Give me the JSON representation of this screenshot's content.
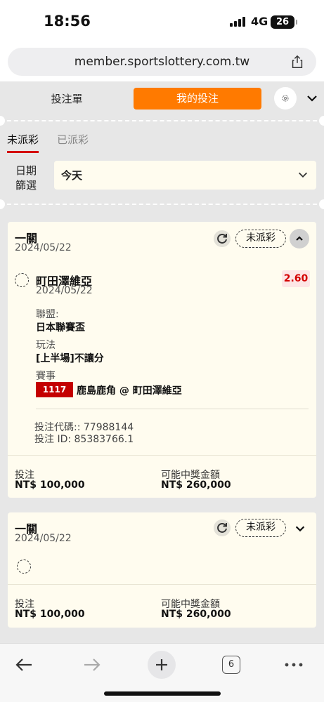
{
  "status_bar": {
    "time": "18:56",
    "network": "4G",
    "battery": "26"
  },
  "browser": {
    "url": "member.sportslottery.com.tw",
    "open_tabs": "6"
  },
  "nav": {
    "tab_bets": "投注單",
    "tab_my_bets": "我的投注",
    "accent_color": "#ff7a00"
  },
  "filters": {
    "tabs": [
      "未派彩",
      "已派彩"
    ],
    "active_tab": "未派彩",
    "date_label": "日期篩選",
    "date_label_line1": "日期",
    "date_label_line2": "篩選",
    "date_value": "今天"
  },
  "bets": [
    {
      "type": "一關",
      "date": "2024/05/22",
      "status": "未派彩",
      "expanded": true,
      "selection": {
        "team": "町田澤維亞",
        "date": "2024/05/22",
        "odds": "2.60",
        "league_label": "聯盟:",
        "league": "日本聯賽盃",
        "market_label": "玩法",
        "market": "[上半場]不讓分",
        "event_label": "賽事",
        "event_id": "1117",
        "event_name": "鹿島鹿角 @ 町田澤維亞"
      },
      "bet_code": "投注代碼:: 77988144",
      "bet_id": "投注 ID: 85383766.1",
      "stake_label": "投注",
      "stake": "NT$ 100,000",
      "payout_label": "可能中獎金額",
      "payout": "NT$ 260,000"
    },
    {
      "type": "一關",
      "date": "2024/05/22",
      "status": "未派彩",
      "expanded": false,
      "stake_label": "投注",
      "stake": "NT$ 100,000",
      "payout_label": "可能中獎金額",
      "payout": "NT$ 260,000"
    }
  ],
  "icons": {
    "share": "share-icon",
    "settings": "gear-icon",
    "refresh": "refresh-icon",
    "back": "back-arrow-icon",
    "forward": "forward-arrow-icon",
    "new_tab": "plus-icon",
    "more": "more-icon"
  }
}
